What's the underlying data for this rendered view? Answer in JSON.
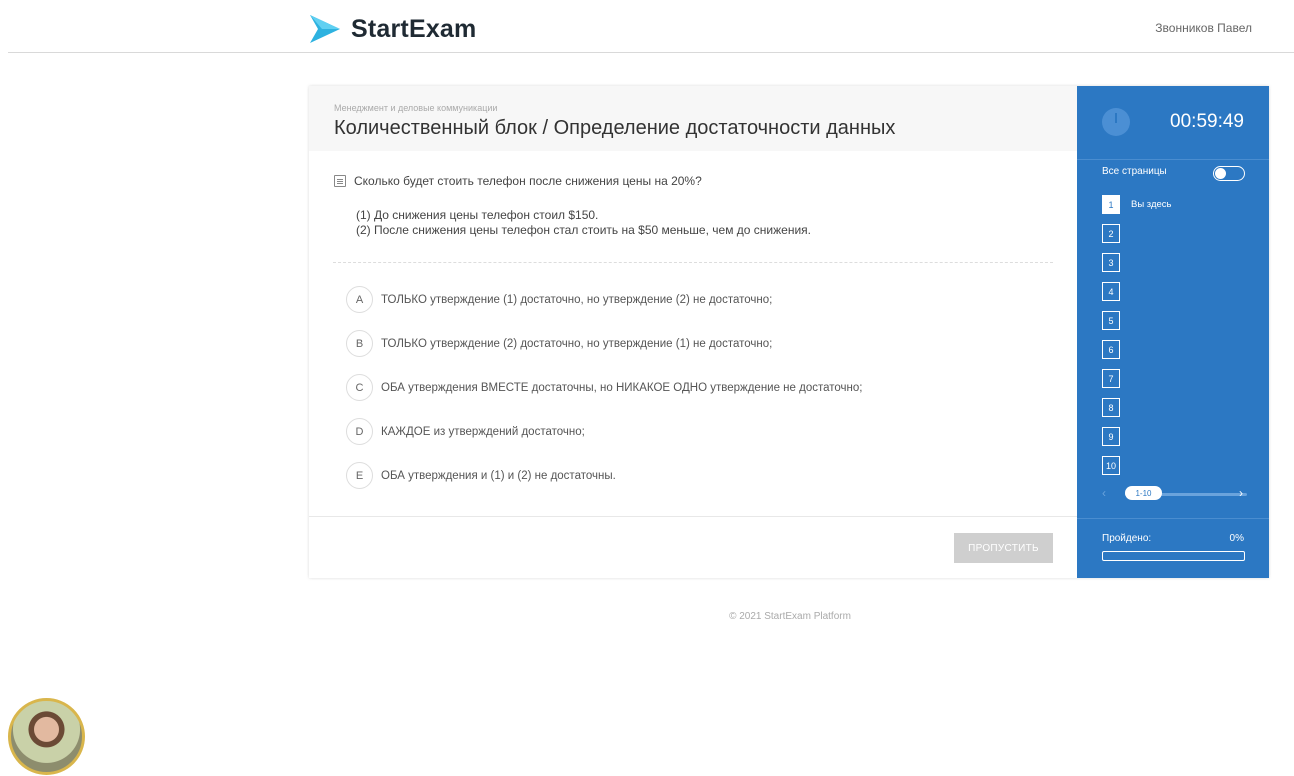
{
  "header": {
    "logo_text": "StartExam",
    "user_name": "Звонников Павел"
  },
  "question": {
    "category": "Менеджмент и деловые коммуникации",
    "title": "Количественный блок / Определение достаточности данных",
    "text": "Сколько будет стоить телефон после снижения цены на 20%?",
    "statements": [
      "(1)  До снижения цены телефон стоил $150.",
      "(2)  После снижения цены телефон стал стоить на $50 меньше, чем  до снижения."
    ],
    "answers": [
      {
        "letter": "A",
        "text": "ТОЛЬКО утверждение (1) достаточно, но утверждение (2) не достаточно;"
      },
      {
        "letter": "B",
        "text": "ТОЛЬКО утверждение (2) достаточно, но утверждение (1) не достаточно;"
      },
      {
        "letter": "C",
        "text": "ОБА утверждения ВМЕСТЕ достаточны, но НИКАКОЕ ОДНО утверждение не достаточно;"
      },
      {
        "letter": "D",
        "text": "КАЖДОЕ из утверждений достаточно;"
      },
      {
        "letter": "E",
        "text": "ОБА утверждения и (1) и (2) не достаточны."
      }
    ],
    "skip_label": "ПРОПУСТИТЬ"
  },
  "sidebar": {
    "timer": "00:59:49",
    "all_pages_label": "Все страницы",
    "all_pages_enabled": false,
    "current_label": "Вы здесь",
    "pages": [
      "1",
      "2",
      "3",
      "4",
      "5",
      "6",
      "7",
      "8",
      "9",
      "10"
    ],
    "current_page": "1",
    "pager_range": "1-10",
    "pager_prev": "‹",
    "pager_next": "›",
    "progress_label": "Пройдено:",
    "progress_value": "0%",
    "progress_fraction": 0
  },
  "footer": {
    "copyright": "© 2021 StartExam Platform"
  },
  "colors": {
    "accent": "#2c78c3",
    "logo": "#2db2e0"
  }
}
